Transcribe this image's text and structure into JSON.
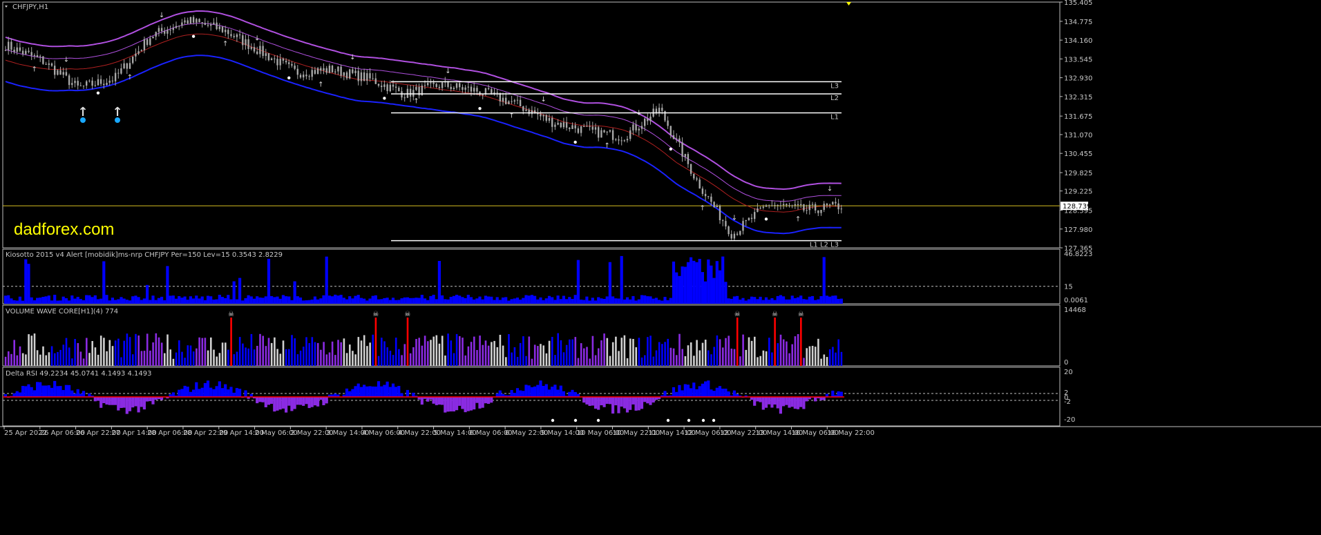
{
  "window": {
    "symbol_label": "CHFJPY,H1",
    "watermark": "dadforex.com"
  },
  "colors": {
    "bg": "#000000",
    "frame": "#c0c0c0",
    "candle": "#a8a8a8",
    "band_upper": "#b050e0",
    "band_lower": "#1a22ff",
    "band_mid": "#b02020",
    "price_line": "#d8c020",
    "level": "#ffffff",
    "arrow_up": "#00d000",
    "arrow_down": "#00d000",
    "signal_yellow": "#ffff00",
    "signal_blue": "#18a8ff",
    "hist_blue": "#0000ff",
    "hist_purple": "#8a2be2",
    "hist_white": "#d0d0d0",
    "hist_red": "#ff0000"
  },
  "main": {
    "price_axis_ticks": [
      "135.405",
      "134.775",
      "134.160",
      "133.545",
      "132.930",
      "132.315",
      "131.675",
      "131.070",
      "130.455",
      "129.825",
      "129.225",
      "128.595",
      "127.980",
      "127.365"
    ],
    "current_price": "128.739",
    "levels": [
      {
        "name": "L3",
        "price": 132.8
      },
      {
        "name": "L2",
        "price": 132.4
      },
      {
        "name": "L1",
        "price": 131.78
      },
      {
        "name": "L1 L2 L3",
        "price": 127.6
      }
    ],
    "icon_buy_arrow": "up-arrow-icon",
    "icon_sell_arrow": "down-arrow-icon",
    "icon_dot": "dot-icon"
  },
  "indicator1": {
    "title": "Kiosotto 2015 v4 Alert [mobidik]ms-nrp CHFJPY Per=150 Lev=15 0.3543 2.8229",
    "axis_ticks": [
      "46.8223",
      "15",
      "0.0061"
    ],
    "level_value": 15
  },
  "indicator2": {
    "title": "VOLUME WAVE CORE[H1](4) 774",
    "axis_ticks": [
      "14468",
      "0"
    ],
    "icon": "skull-icon"
  },
  "indicator3": {
    "title": "Delta RSI 49.2234 45.0741 4.1493 4.1493",
    "axis_ticks": [
      "20",
      "2",
      "0",
      "-2",
      "-20"
    ]
  },
  "time_axis": [
    "25 Apr 2022",
    "26 Apr 06:00",
    "26 Apr 22:00",
    "27 Apr 14:00",
    "28 Apr 06:00",
    "28 Apr 22:00",
    "29 Apr 14:00",
    "2 May 06:00",
    "2 May 22:00",
    "3 May 14:00",
    "4 May 06:00",
    "4 May 22:00",
    "5 May 14:00",
    "6 May 06:00",
    "6 May 22:00",
    "9 May 14:00",
    "10 May 06:00",
    "10 May 22:00",
    "11 May 14:00",
    "12 May 06:00",
    "12 May 22:00",
    "13 May 14:00",
    "16 May 06:00",
    "16 May 22:00"
  ],
  "chart_data": {
    "type": "line",
    "title": "CHFJPY,H1",
    "price_range": [
      127.365,
      135.405
    ],
    "x": [
      "25 Apr 2022",
      "26 Apr 06:00",
      "26 Apr 22:00",
      "27 Apr 14:00",
      "28 Apr 06:00",
      "28 Apr 22:00",
      "29 Apr 14:00",
      "2 May 06:00",
      "2 May 22:00",
      "3 May 14:00",
      "4 May 06:00",
      "4 May 22:00",
      "5 May 14:00",
      "6 May 06:00",
      "6 May 22:00",
      "9 May 14:00",
      "10 May 06:00",
      "10 May 22:00",
      "11 May 14:00",
      "12 May 06:00",
      "12 May 22:00",
      "13 May 14:00",
      "16 May 06:00",
      "16 May 22:00"
    ],
    "series": [
      {
        "values": [
          134.0,
          133.5,
          132.6,
          132.9,
          134.3,
          134.8,
          134.5,
          133.8,
          133.1,
          133.2,
          132.9,
          132.4,
          132.7,
          132.5,
          132.1,
          131.5,
          131.2,
          131.0,
          131.9,
          129.6,
          127.8,
          128.8,
          128.6,
          128.74
        ]
      }
    ],
    "ylim": [
      127.365,
      135.405
    ]
  }
}
